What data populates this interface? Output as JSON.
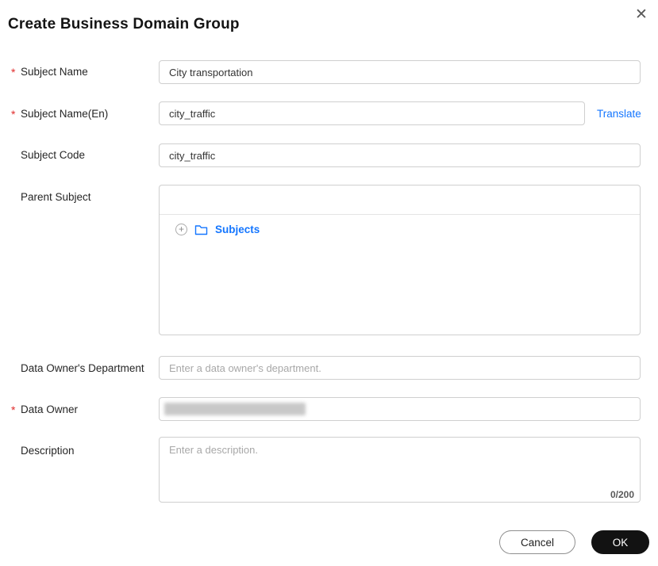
{
  "header": {
    "title": "Create Business Domain Group",
    "close_glyph": "✕"
  },
  "form": {
    "required_marker": "*",
    "subject_name": {
      "label": "Subject Name",
      "required": true,
      "value": "City transportation"
    },
    "subject_name_en": {
      "label": "Subject Name(En)",
      "required": true,
      "value": "city_traffic",
      "translate_link": "Translate"
    },
    "subject_code": {
      "label": "Subject Code",
      "required": false,
      "value": "city_traffic"
    },
    "parent_subject": {
      "label": "Parent Subject",
      "required": false,
      "expand_icon": "+",
      "root_node": "Subjects"
    },
    "data_owner_department": {
      "label": "Data Owner's Department",
      "required": false,
      "placeholder": "Enter a data owner's department."
    },
    "data_owner": {
      "label": "Data Owner",
      "required": true,
      "value_redacted": true
    },
    "description": {
      "label": "Description",
      "required": false,
      "placeholder": "Enter a description.",
      "char_counter": "0/200"
    }
  },
  "footer": {
    "cancel_label": "Cancel",
    "ok_label": "OK"
  },
  "colors": {
    "accent_blue": "#1476ff",
    "required_red": "#e02b2b",
    "ok_button_bg": "#121212",
    "input_border": "#cfcfcf"
  }
}
